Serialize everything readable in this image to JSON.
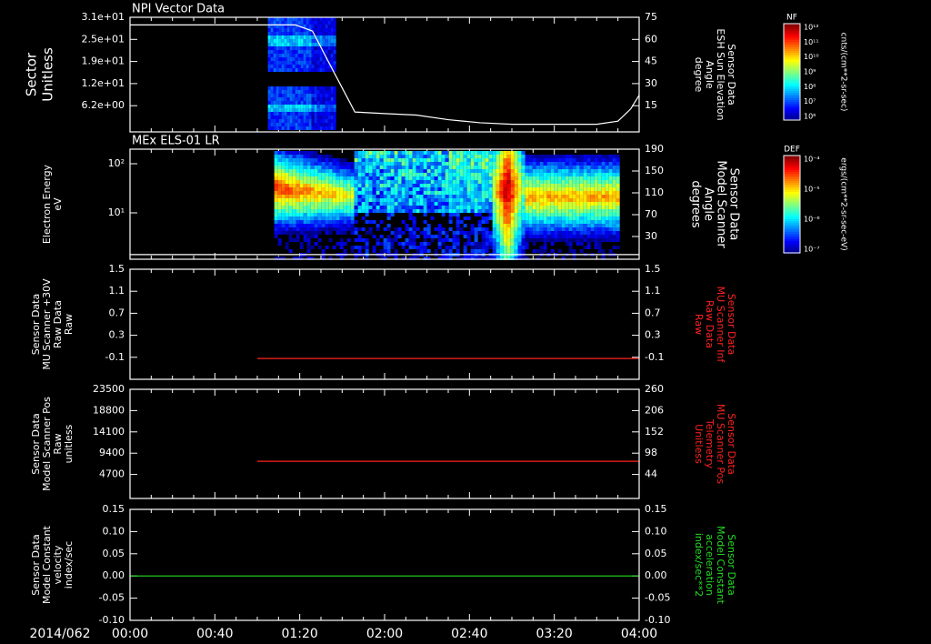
{
  "date_label": "2014/062",
  "x_ticks": [
    "00:00",
    "00:40",
    "01:20",
    "02:00",
    "02:40",
    "03:20",
    "04:00"
  ],
  "panels": [
    {
      "id": "npi",
      "title": "NPI Vector Data",
      "left_label": [
        "Sector",
        "Unitless"
      ],
      "left_ticks": [
        "3.1e+01",
        "2.5e+01",
        "1.9e+01",
        "1.2e+01",
        "6.2e+00"
      ],
      "right_ticks": [
        "75",
        "60",
        "45",
        "30",
        "15"
      ],
      "right_label": [
        "Sensor Data",
        "ESH Sun Elevation",
        "Angle",
        "degree"
      ],
      "right_label_color": "#ffffff",
      "colorbar": {
        "label": "NF",
        "unit": "cnts/(cm**2-sr-sec)",
        "ticks": [
          "10¹²",
          "10¹¹",
          "10¹⁰",
          "10⁹",
          "10⁸",
          "10⁷",
          "10⁶"
        ]
      }
    },
    {
      "id": "els",
      "title": "MEx ELS-01 LR",
      "left_label": [
        "Electron Energy",
        "eV"
      ],
      "left_ticks": [
        "10²",
        "10¹"
      ],
      "right_ticks": [
        "190",
        "150",
        "110",
        "70",
        "30"
      ],
      "right_label": [
        "Sensor Data",
        "Model Scanner",
        "Angle",
        "degrees"
      ],
      "right_label_color": "#ffffff",
      "colorbar": {
        "label": "DEF",
        "unit": "ergs/(cm**2-sr-sec-eV)",
        "ticks": [
          "10⁻⁴",
          "10⁻⁵",
          "10⁻⁶",
          "10⁻⁷"
        ]
      }
    },
    {
      "id": "mu_raw",
      "left_label": [
        "Sensor Data",
        "MU Scanner +30V",
        "Raw Data",
        "Raw"
      ],
      "left_ticks": [
        "1.5",
        "1.1",
        "0.7",
        "0.3",
        "-0.1"
      ],
      "right_ticks": [
        "1.5",
        "1.1",
        "0.7",
        "0.3",
        "-0.1"
      ],
      "right_label": [
        "Sensor Data",
        "MU Scanner Inf",
        "Raw Data",
        "Raw"
      ],
      "right_label_color": "#ff2020"
    },
    {
      "id": "mu_pos",
      "left_label": [
        "Sensor Data",
        "Model Scanner Pos",
        "Raw",
        "unitless"
      ],
      "left_ticks": [
        "23500",
        "18800",
        "14100",
        "9400",
        "4700"
      ],
      "right_ticks": [
        "260",
        "206",
        "152",
        "98",
        "44"
      ],
      "right_label": [
        "Sensor Data",
        "MU Scanner Pos",
        "Telemetry",
        "Unitless"
      ],
      "right_label_color": "#ff2020"
    },
    {
      "id": "const",
      "left_label": [
        "Sensor Data",
        "Model Constant",
        "velocity",
        "index/sec"
      ],
      "left_ticks": [
        "0.15",
        "0.10",
        "0.05",
        "0.00",
        "-0.05",
        "-0.10"
      ],
      "right_ticks": [
        "0.15",
        "0.10",
        "0.05",
        "0.00",
        "-0.05",
        "-0.10"
      ],
      "right_label": [
        "Sensor Data",
        "Model Constant",
        "acceleration",
        "index/sec**2"
      ],
      "right_label_color": "#22dd22"
    }
  ],
  "chart_data": [
    {
      "type": "line",
      "title": "NPI Vector Data",
      "ylabel": "Sector Unitless",
      "y2label": "Sensor Data ESH Sun Elevation Angle degree",
      "ylim": [
        0,
        31
      ],
      "y2lim": [
        0,
        75
      ],
      "x_range_minutes": [
        0,
        240
      ],
      "spectrogram_extent_minutes": [
        65,
        97
      ],
      "series": [
        {
          "name": "ESH Sun Elevation Angle",
          "color": "#ffffff",
          "x": [
            0,
            65,
            78,
            86,
            95,
            106,
            120,
            135,
            150,
            165,
            180,
            200,
            220,
            230,
            236,
            240
          ],
          "y": [
            70,
            70,
            70,
            66,
            42,
            13,
            12,
            11,
            8,
            6,
            5,
            5,
            5,
            7,
            15,
            24
          ]
        }
      ]
    },
    {
      "type": "heatmap",
      "title": "MEx ELS-01 LR",
      "ylabel": "Electron Energy eV",
      "y2label": "Sensor Data Model Scanner Angle degrees",
      "y2lim": [
        0,
        190
      ],
      "x_range_minutes": [
        0,
        240
      ],
      "spectrogram_extent_minutes": [
        68,
        230
      ],
      "series": [
        {
          "name": "Model Scanner Angle",
          "color": "#ffffff",
          "x": [
            0,
            240
          ],
          "y": [
            8,
            8
          ]
        }
      ]
    },
    {
      "type": "line",
      "ylabel": "Sensor Data MU Scanner +30V Raw Data Raw",
      "y2label": "Sensor Data MU Scanner Inf Raw Data Raw",
      "ylim": [
        -0.35,
        1.5
      ],
      "series": [
        {
          "name": "MU Scanner Inf Raw Data",
          "color": "#ff2020",
          "x": [
            60,
            240
          ],
          "y": [
            0.0,
            0.0
          ]
        }
      ]
    },
    {
      "type": "line",
      "ylabel": "Sensor Data Model Scanner Pos Raw unitless",
      "y2label": "Sensor Data MU Scanner Pos Telemetry Unitless",
      "ylim": [
        0,
        23500
      ],
      "series": [
        {
          "name": "MU Scanner Pos Telemetry",
          "color": "#ff2020",
          "x": [
            60,
            240
          ],
          "y": [
            8000,
            8000
          ]
        }
      ]
    },
    {
      "type": "line",
      "ylabel": "Sensor Data Model Constant velocity index/sec",
      "y2label": "Sensor Data Model Constant acceleration index/sec**2",
      "ylim": [
        -0.1,
        0.15
      ],
      "series": [
        {
          "name": "Model Constant acceleration",
          "color": "#22dd22",
          "x": [
            0,
            240
          ],
          "y": [
            0.0,
            0.0
          ]
        }
      ]
    }
  ]
}
